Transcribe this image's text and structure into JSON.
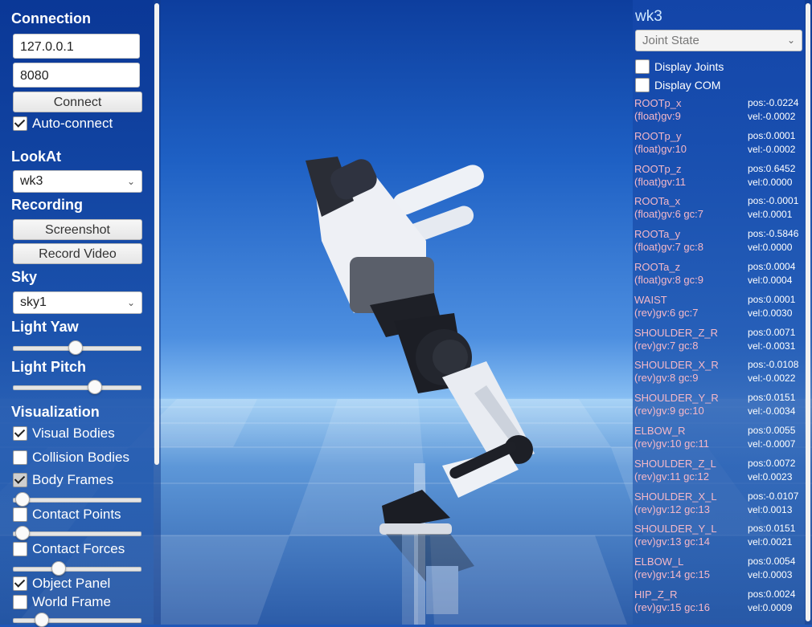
{
  "left_panel": {
    "connection_title": "Connection",
    "ip_value": "127.0.0.1",
    "port_value": "8080",
    "connect_label": "Connect",
    "autoconnect_label": "Auto-connect",
    "lookat_title": "LookAt",
    "lookat_value": "wk3",
    "recording_title": "Recording",
    "screenshot_label": "Screenshot",
    "record_label": "Record Video",
    "sky_title": "Sky",
    "sky_value": "sky1",
    "light_yaw_title": "Light Yaw",
    "light_yaw_level": 0.48,
    "light_pitch_title": "Light Pitch",
    "light_pitch_level": 0.63,
    "visualization_title": "Visualization",
    "checkboxes": [
      {
        "label": "Visual Bodies",
        "checked": true
      },
      {
        "label": "Collision Bodies",
        "checked": false
      },
      {
        "label": "Body Frames",
        "checked": true
      },
      {
        "label": "Contact Points",
        "checked": false
      },
      {
        "label": "Contact Forces",
        "checked": false
      },
      {
        "label": "Object Panel",
        "checked": true
      },
      {
        "label": "World Frame",
        "checked": false
      }
    ],
    "body_frames_level": 0.07,
    "contact_points_level": 0.07,
    "contact_forces_level": 0.35,
    "world_frame_level": 0.22
  },
  "right_panel": {
    "robot_name": "wk3",
    "state_select": "Joint State",
    "display_joints_label": "Display Joints",
    "display_com_label": "Display COM",
    "joints": [
      {
        "name": "ROOTp_x",
        "type": "(float)gv:9",
        "pos": "pos:-0.0224",
        "vel": "vel:-0.0002"
      },
      {
        "name": "ROOTp_y",
        "type": "(float)gv:10",
        "pos": "pos:0.0001",
        "vel": "vel:-0.0002"
      },
      {
        "name": "ROOTp_z",
        "type": "(float)gv:11",
        "pos": "pos:0.6452",
        "vel": "vel:0.0000"
      },
      {
        "name": "ROOTa_x",
        "type": "(float)gv:6 gc:7",
        "pos": "pos:-0.0001",
        "vel": "vel:0.0001"
      },
      {
        "name": "ROOTa_y",
        "type": "(float)gv:7 gc:8",
        "pos": "pos:-0.5846",
        "vel": "vel:0.0000"
      },
      {
        "name": "ROOTa_z",
        "type": "(float)gv:8 gc:9",
        "pos": "pos:0.0004",
        "vel": "vel:0.0004"
      },
      {
        "name": "WAIST",
        "type": "(rev)gv:6 gc:7",
        "pos": "pos:0.0001",
        "vel": "vel:0.0030"
      },
      {
        "name": "SHOULDER_Z_R",
        "type": "(rev)gv:7 gc:8",
        "pos": "pos:0.0071",
        "vel": "vel:-0.0031"
      },
      {
        "name": "SHOULDER_X_R",
        "type": "(rev)gv:8 gc:9",
        "pos": "pos:-0.0108",
        "vel": "vel:-0.0022"
      },
      {
        "name": "SHOULDER_Y_R",
        "type": "(rev)gv:9 gc:10",
        "pos": "pos:0.0151",
        "vel": "vel:-0.0034"
      },
      {
        "name": "ELBOW_R",
        "type": "(rev)gv:10 gc:11",
        "pos": "pos:0.0055",
        "vel": "vel:-0.0007"
      },
      {
        "name": "SHOULDER_Z_L",
        "type": "(rev)gv:11 gc:12",
        "pos": "pos:0.0072",
        "vel": "vel:0.0023"
      },
      {
        "name": "SHOULDER_X_L",
        "type": "(rev)gv:12 gc:13",
        "pos": "pos:-0.0107",
        "vel": "vel:0.0013"
      },
      {
        "name": "SHOULDER_Y_L",
        "type": "(rev)gv:13 gc:14",
        "pos": "pos:0.0151",
        "vel": "vel:0.0021"
      },
      {
        "name": "ELBOW_L",
        "type": "(rev)gv:14 gc:15",
        "pos": "pos:0.0054",
        "vel": "vel:0.0003"
      },
      {
        "name": "HIP_Z_R",
        "type": "(rev)gv:15 gc:16",
        "pos": "pos:0.0024",
        "vel": "vel:0.0009"
      }
    ]
  }
}
